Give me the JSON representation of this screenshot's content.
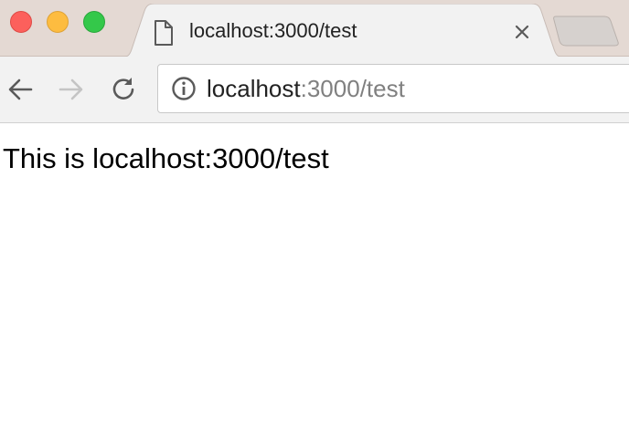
{
  "window": {
    "controls": [
      "close",
      "minimize",
      "maximize"
    ]
  },
  "tab": {
    "title": "localhost:3000/test",
    "icon": "file-icon",
    "close_icon": "close-icon"
  },
  "toolbar": {
    "back_icon": "back-arrow-icon",
    "forward_icon": "forward-arrow-icon",
    "reload_icon": "reload-icon"
  },
  "address_bar": {
    "host": "localhost",
    "path": ":3000/test",
    "info_icon": "info-icon"
  },
  "page": {
    "text": "This is localhost:3000/test"
  },
  "colors": {
    "titlebar_bg": "#e4d9d3",
    "toolbar_bg": "#f2f2f2",
    "traffic_close": "#fc605c",
    "traffic_minimize": "#fdbc40",
    "traffic_maximize": "#34c84a",
    "url_path": "#808080"
  }
}
